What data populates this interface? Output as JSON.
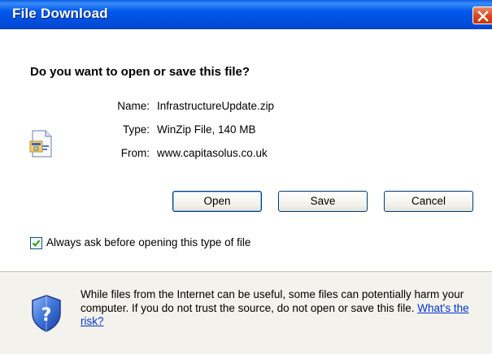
{
  "window": {
    "title": "File Download"
  },
  "dialog": {
    "question": "Do you want to open or save this file?",
    "file_icon": "zip-file-icon",
    "fields": [
      {
        "label": "Name:",
        "value": "InfrastructureUpdate.zip"
      },
      {
        "label": "Type:",
        "value": "WinZip File, 140 MB"
      },
      {
        "label": "From:",
        "value": "www.capitasolus.co.uk"
      }
    ],
    "buttons": {
      "open": "Open",
      "save": "Save",
      "cancel": "Cancel"
    },
    "checkbox": {
      "label": "Always ask before opening this type of file",
      "checked": true
    }
  },
  "warning": {
    "icon": "shield-question-icon",
    "text": "While files from the Internet can be useful, some files can potentially harm your computer. If you do not trust the source, do not open or save this file.",
    "link": "What's the risk?"
  },
  "colors": {
    "titlebar": "#0054e3",
    "close": "#d8461a",
    "dialog_bg": "#ece9d8",
    "link": "#0033cc"
  }
}
